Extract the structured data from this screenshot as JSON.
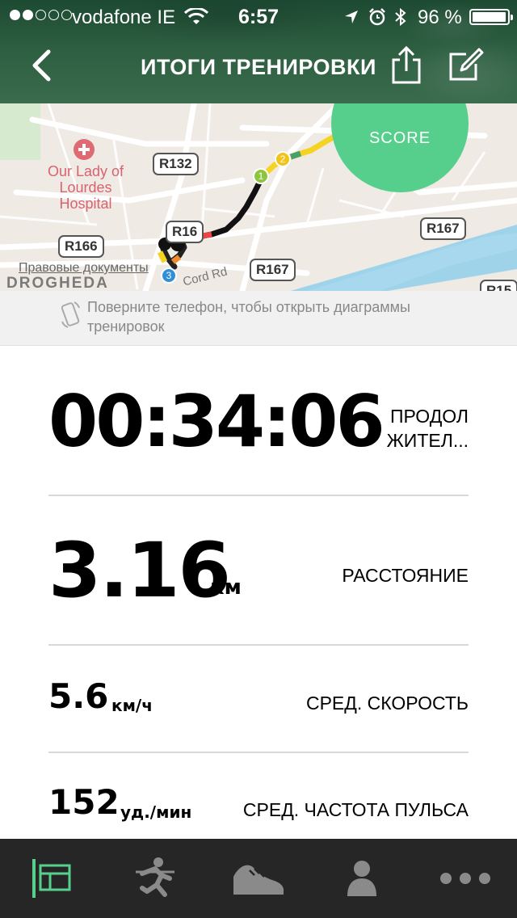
{
  "status_bar": {
    "carrier": "vodafone IE",
    "time": "6:57",
    "battery_percent": "96 %",
    "signal_bars_filled": 2,
    "signal_bars_total": 5
  },
  "header": {
    "title": "ИТОГИ ТРЕНИРОВКИ"
  },
  "map": {
    "score_value": "",
    "score_label": "SCORE",
    "hospital": "Our Lady of Lourdes Hospital",
    "roads": [
      "R132",
      "R166",
      "R167",
      "R167",
      "R16",
      "R15"
    ],
    "street": "Cord Rd",
    "town": "DROGHEDA",
    "legal_link": "Правовые документы",
    "km_markers": [
      "1",
      "2",
      "3"
    ]
  },
  "rotate_hint": {
    "text": "Поверните телефон, чтобы открыть диаграммы тренировок"
  },
  "stats": {
    "duration": {
      "value": "00:34:06",
      "label": "ПРОДОЛ ЖИТЕЛ..."
    },
    "distance": {
      "value": "3.16",
      "unit": "км",
      "label": "РАССТОЯНИЕ"
    },
    "avg_speed": {
      "value": "5.6",
      "unit": "км/ч",
      "label": "СРЕД. СКОРОСТЬ"
    },
    "avg_heart_rate": {
      "value": "152",
      "unit": "уд./мин",
      "label": "СРЕД. ЧАСТОТА ПУЛЬСА"
    }
  },
  "tab_bar": {
    "tabs": [
      {
        "icon": "summary-icon",
        "active": true
      },
      {
        "icon": "runner-icon",
        "active": false
      },
      {
        "icon": "shoe-icon",
        "active": false
      },
      {
        "icon": "profile-icon",
        "active": false
      },
      {
        "icon": "more-icon",
        "active": false
      }
    ],
    "active_color": "#55d18d",
    "inactive_color": "#8a8a8a"
  },
  "colors": {
    "header_green": "#2d5e41",
    "score_green": "#56cf8c",
    "tab_bar_bg": "#262626",
    "water": "#9ed3ea"
  }
}
